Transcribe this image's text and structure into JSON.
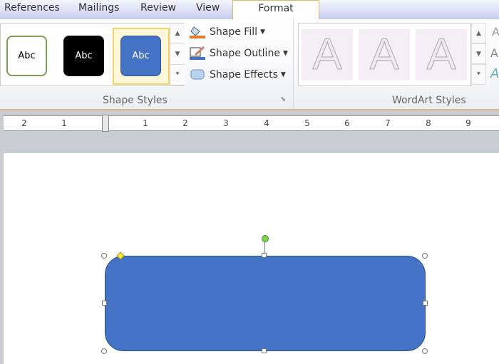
{
  "tabs": [
    "References",
    "Mailings",
    "Review",
    "View",
    "Format"
  ],
  "active_tab": "Format",
  "shape_styles": {
    "swatches": [
      {
        "label": "Abc",
        "fill": "#ffffff",
        "border": "#77a04f",
        "text": "#000000"
      },
      {
        "label": "Abc",
        "fill": "#000000",
        "border": "#000000",
        "text": "#ffffff"
      },
      {
        "label": "Abc",
        "fill": "#4472c4",
        "border": "#2f528f",
        "text": "#ffffff"
      }
    ],
    "commands": [
      "Shape Fill",
      "Shape Outline",
      "Shape Effects"
    ],
    "group_label": "Shape Styles"
  },
  "wordart": {
    "glyphs": [
      "A",
      "A",
      "A"
    ],
    "group_label": "WordArt Styles"
  },
  "ruler": {
    "left": [
      "2",
      "1"
    ],
    "right": [
      "1",
      "2",
      "3",
      "4",
      "5",
      "6",
      "7",
      "8",
      "9"
    ]
  },
  "shape": {
    "fill": "#4472c4",
    "outline": "#2f528f"
  }
}
